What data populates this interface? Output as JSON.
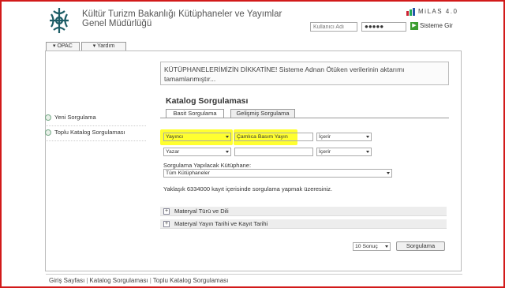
{
  "header": {
    "title": "Kültür Turizm Bakanlığı Kütüphaneler ve Yayımlar Genel Müdürlüğü",
    "brand": "MiLAS 4.0",
    "login": {
      "user_placeholder": "Kullanıcı Adı",
      "password_value": "●●●●●",
      "submit_label": "Sisteme Gir"
    }
  },
  "menu": {
    "items": [
      {
        "label": "▾ OPAC"
      },
      {
        "label": "▾ Yardım"
      }
    ]
  },
  "sidebar": {
    "items": [
      {
        "label": "Yeni Sorgulama"
      },
      {
        "label": "Toplu Katalog Sorgulaması"
      }
    ]
  },
  "notice": "KÜTÜPHANELERİMİZİN DİKKATİNE! Sisteme Adnan Ötüken verilerinin aktarımı tamamlanmıştır...",
  "catalog": {
    "title": "Katalog Sorgulaması",
    "tabs": [
      {
        "label": "Basit Sorgulama",
        "active": true
      },
      {
        "label": "Gelişmiş Sorgulama",
        "active": false
      }
    ],
    "row1": {
      "field": "Yayıncı",
      "value": "Çamlıca Basım Yayın",
      "op": "İçerir"
    },
    "row2": {
      "field": "Yazar",
      "value": "",
      "op": "İçerir"
    },
    "library_label": "Sorgulama Yapılacak Kütüphane:",
    "library_value": "Tüm Kütüphaneler",
    "count_text": "Yaklaşık 6334000 kayıt içerisinde sorgulama yapmak üzeresiniz.",
    "accordions": [
      {
        "label": "Materyal Türü ve Dili"
      },
      {
        "label": "Materyal Yayın Tarihi ve Kayıt Tarihi"
      }
    ],
    "results_select": "10 Sonuç",
    "search_button": "Sorgulama"
  },
  "footer": {
    "links": [
      "Giriş Sayfası",
      "Katalog Sorgulaması",
      "Toplu Katalog Sorgulaması"
    ]
  },
  "colors": {
    "frame": "#d21a1a",
    "highlight": "#ffff30",
    "go": "#3a9d2f"
  }
}
